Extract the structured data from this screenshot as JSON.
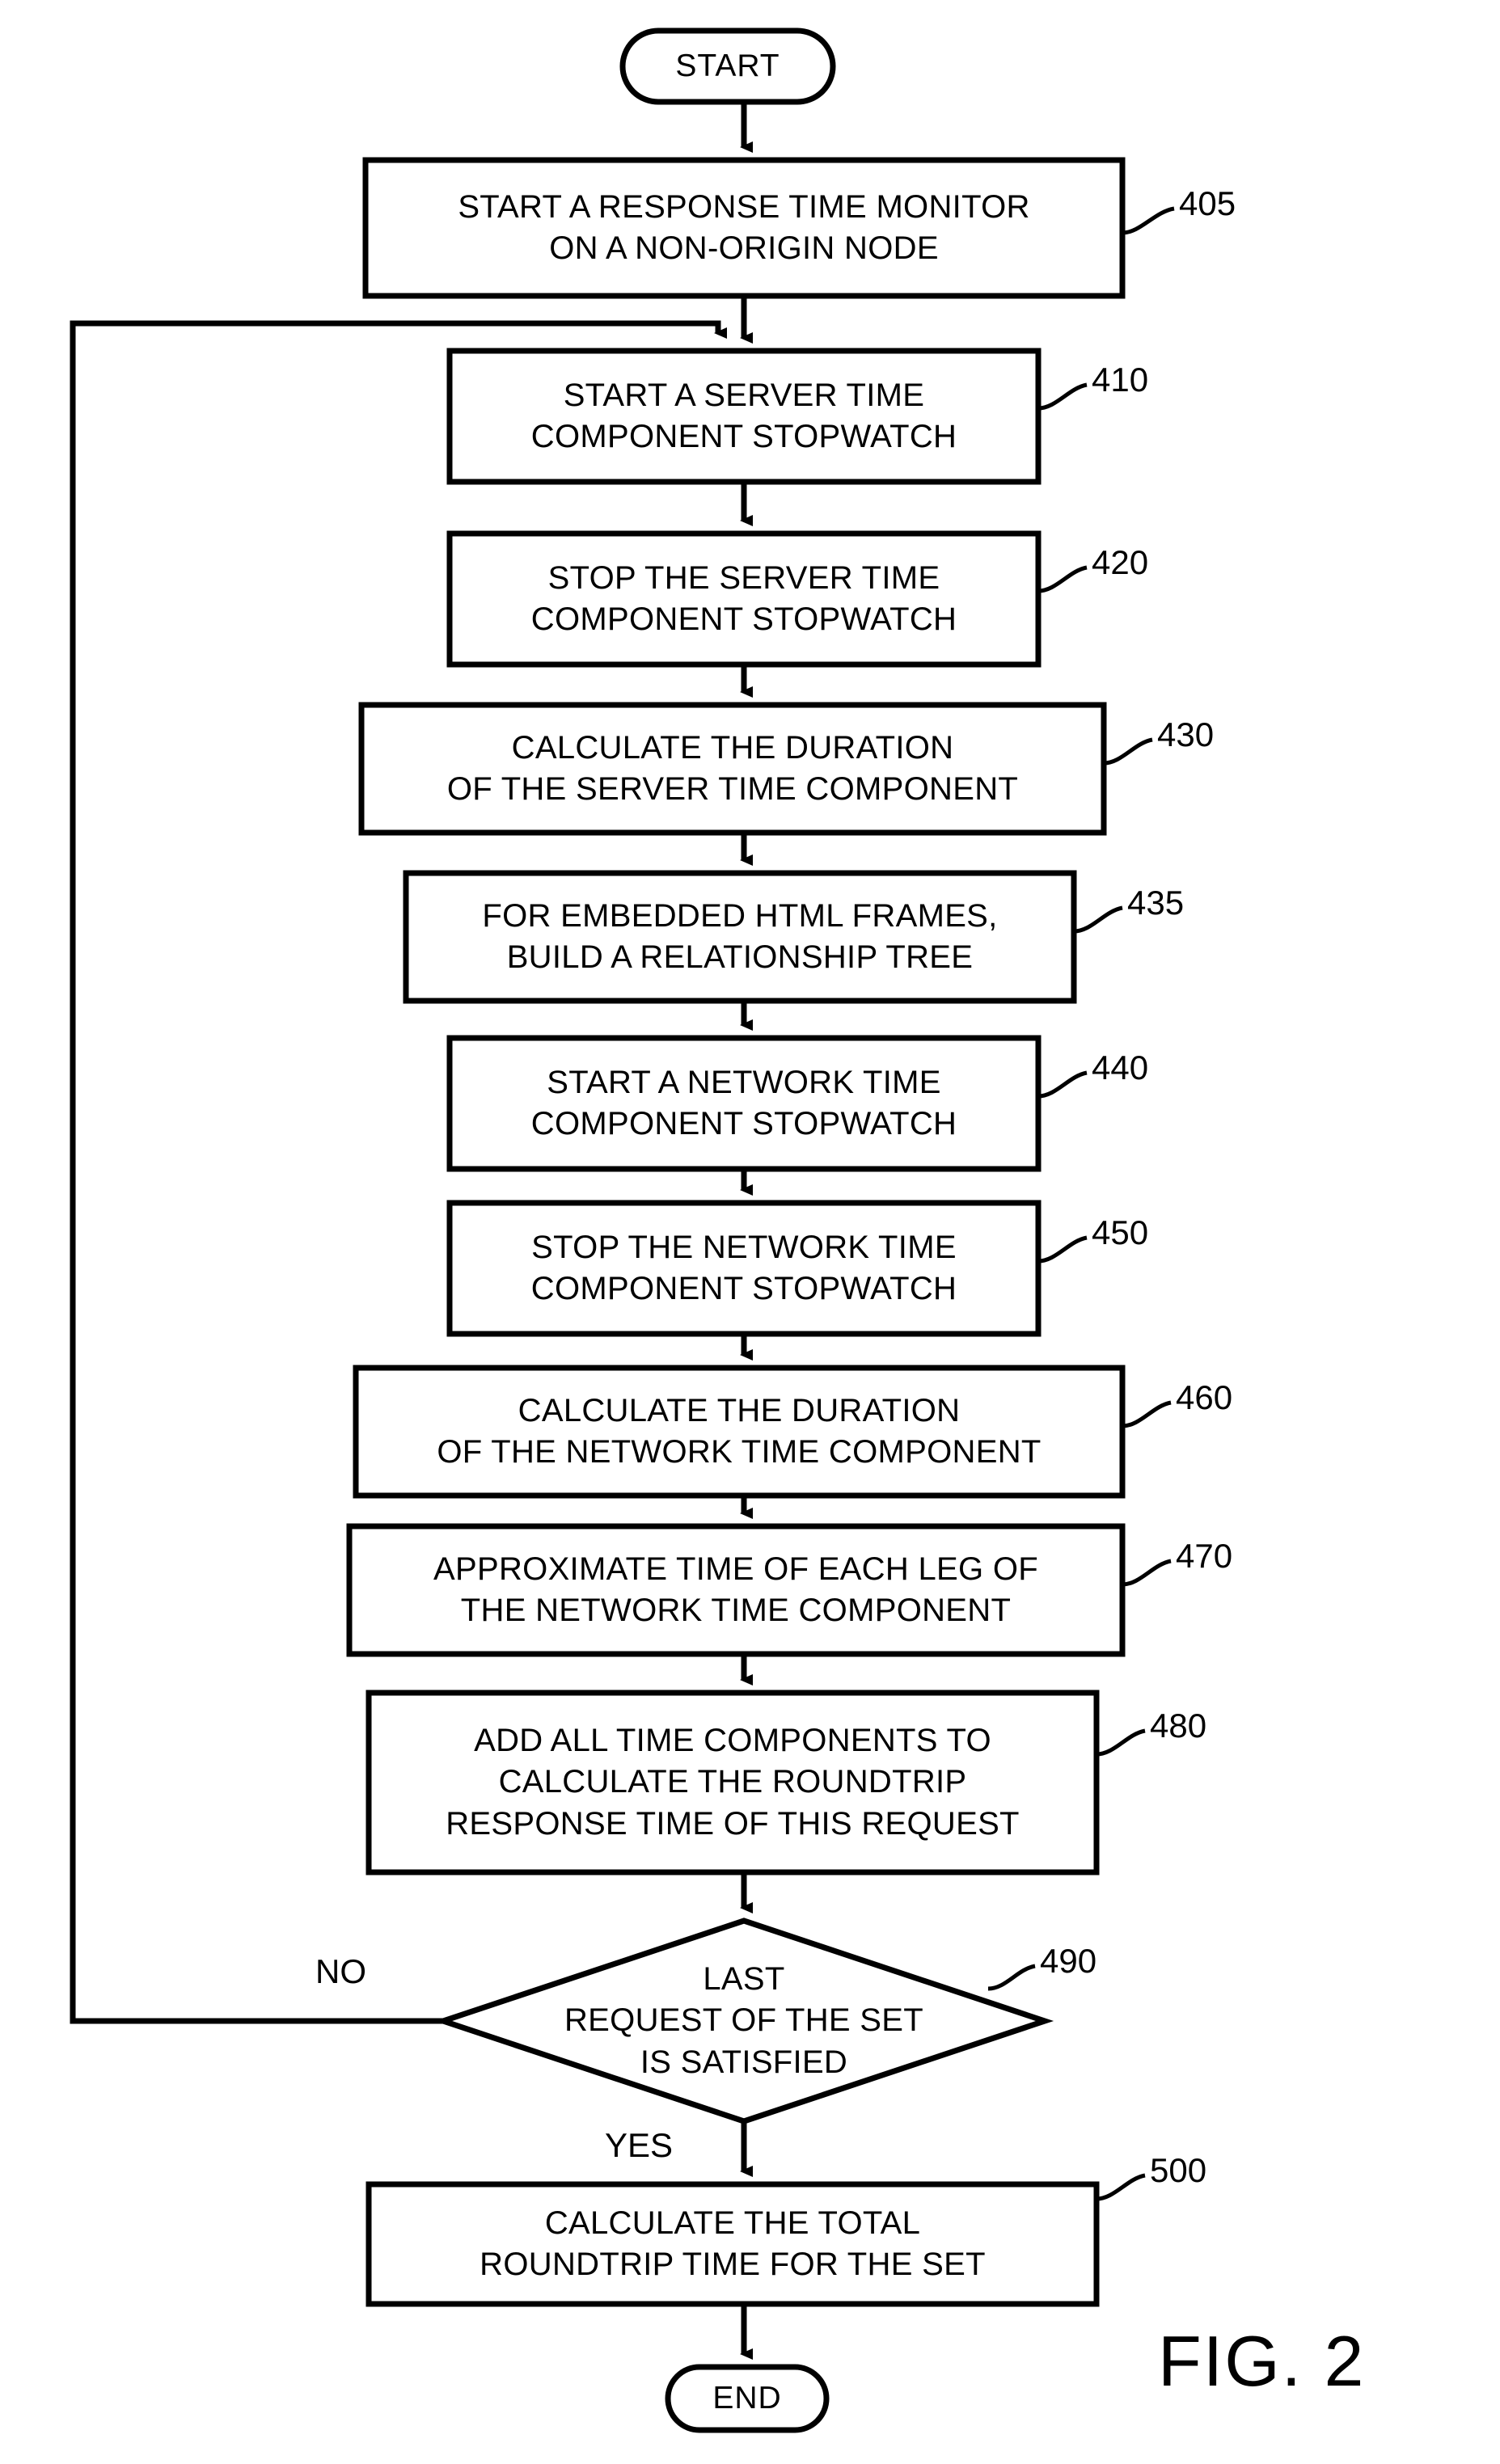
{
  "figure": {
    "caption": "FIG. 2",
    "type": "patent-flowchart"
  },
  "nodes": {
    "start": {
      "label": "START",
      "shape": "terminal"
    },
    "n405": {
      "label": "START A RESPONSE TIME MONITOR\nON A NON-ORIGIN NODE",
      "ref": "405",
      "shape": "process"
    },
    "n410": {
      "label": "START A SERVER TIME\nCOMPONENT STOPWATCH",
      "ref": "410",
      "shape": "process"
    },
    "n420": {
      "label": "STOP THE SERVER TIME\nCOMPONENT STOPWATCH",
      "ref": "420",
      "shape": "process"
    },
    "n430": {
      "label": "CALCULATE THE DURATION\nOF THE SERVER TIME COMPONENT",
      "ref": "430",
      "shape": "process"
    },
    "n435": {
      "label": "FOR EMBEDDED HTML FRAMES,\nBUILD A RELATIONSHIP TREE",
      "ref": "435",
      "shape": "process"
    },
    "n440": {
      "label": "START A NETWORK TIME\nCOMPONENT STOPWATCH",
      "ref": "440",
      "shape": "process"
    },
    "n450": {
      "label": "STOP THE NETWORK TIME\nCOMPONENT STOPWATCH",
      "ref": "450",
      "shape": "process"
    },
    "n460": {
      "label": "CALCULATE THE DURATION\nOF THE NETWORK TIME COMPONENT",
      "ref": "460",
      "shape": "process"
    },
    "n470": {
      "label": "APPROXIMATE TIME OF EACH LEG OF\nTHE NETWORK TIME COMPONENT",
      "ref": "470",
      "shape": "process"
    },
    "n480": {
      "label": "ADD ALL TIME COMPONENTS TO\nCALCULATE THE ROUNDTRIP\nRESPONSE TIME OF THIS REQUEST",
      "ref": "480",
      "shape": "process"
    },
    "n490": {
      "label": "LAST\nREQUEST OF THE SET\nIS SATISFIED",
      "ref": "490",
      "shape": "decision"
    },
    "n500": {
      "label": "CALCULATE THE TOTAL\nROUNDTRIP TIME FOR THE SET",
      "ref": "500",
      "shape": "process"
    },
    "end": {
      "label": "END",
      "shape": "terminal"
    }
  },
  "branches": {
    "no": "NO",
    "yes": "YES"
  },
  "colors": {
    "stroke": "#000000",
    "background": "#ffffff",
    "text": "#000000"
  }
}
